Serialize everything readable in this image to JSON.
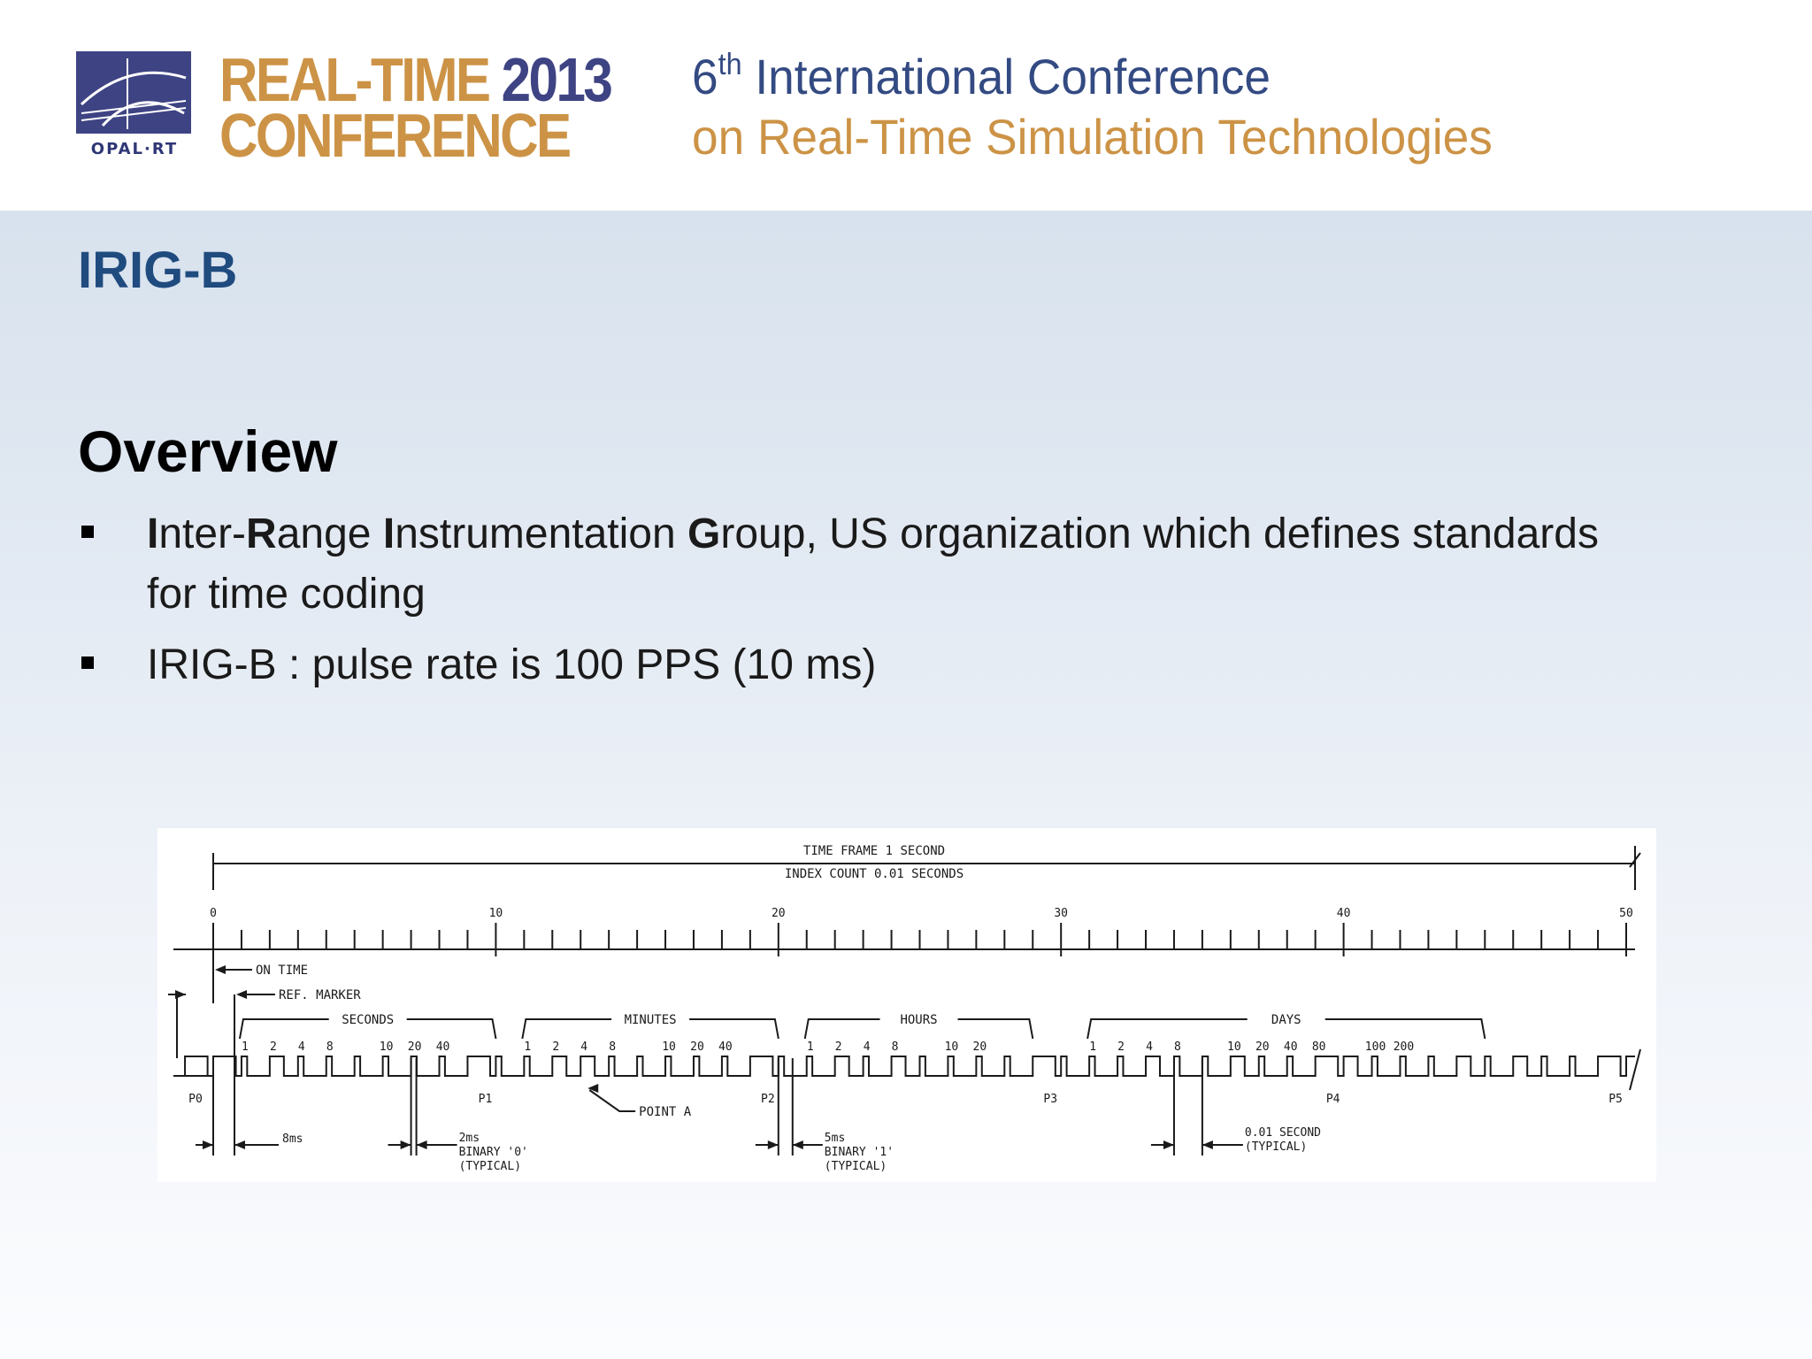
{
  "header": {
    "logo_text": "OPAL·RT",
    "conference_word1": "REAL-TIME",
    "conference_year": "2013",
    "conference_word2": "CONFERENCE",
    "ordinal": "6",
    "ordinal_suffix": "th",
    "subtitle_line1_rest": "International Conference",
    "subtitle_line2": "on Real-Time Simulation Technologies"
  },
  "slide": {
    "title": "IRIG-B",
    "section_heading": "Overview",
    "bullets": [
      {
        "parts": [
          "I",
          "nter-",
          "R",
          "ange ",
          "I",
          "nstrumentation ",
          "G",
          "roup, US organization which defines standards"
        ],
        "line2": "for time coding"
      },
      {
        "text": "IRIG-B : pulse rate is 100 PPS (10 ms)"
      }
    ]
  },
  "diagram": {
    "time_frame_label": "TIME FRAME  1 SECOND",
    "index_count_label": "INDEX COUNT  0.01 SECONDS",
    "index_marks": [
      "0",
      "10",
      "20",
      "30",
      "40",
      "50"
    ],
    "on_time_label": "ON TIME",
    "ref_marker_label": "REF. MARKER",
    "groups": [
      {
        "name": "SECONDS",
        "weights": [
          "1",
          "2",
          "4",
          "8",
          "10",
          "20",
          "40"
        ]
      },
      {
        "name": "MINUTES",
        "weights": [
          "1",
          "2",
          "4",
          "8",
          "10",
          "20",
          "40"
        ]
      },
      {
        "name": "HOURS",
        "weights": [
          "1",
          "2",
          "4",
          "8",
          "10",
          "20"
        ]
      },
      {
        "name": "DAYS",
        "weights": [
          "1",
          "2",
          "4",
          "8",
          "10",
          "20",
          "40",
          "80",
          "100",
          "200"
        ]
      }
    ],
    "position_markers": [
      "P0",
      "P1",
      "P2",
      "P3",
      "P4",
      "P5"
    ],
    "point_a_label": "POINT A",
    "annotations": {
      "eight_ms": "8ms",
      "binary0": [
        "2ms",
        "BINARY '0'",
        "(TYPICAL)"
      ],
      "binary1": [
        "5ms",
        "BINARY '1'",
        "(TYPICAL)"
      ],
      "index_interval": [
        "0.01 SECOND",
        "(TYPICAL)"
      ]
    }
  },
  "colors": {
    "header_bg": "#ffffff",
    "gold": "#cc9346",
    "navy": "#3e4383",
    "title_blue": "#1f4b7f"
  }
}
